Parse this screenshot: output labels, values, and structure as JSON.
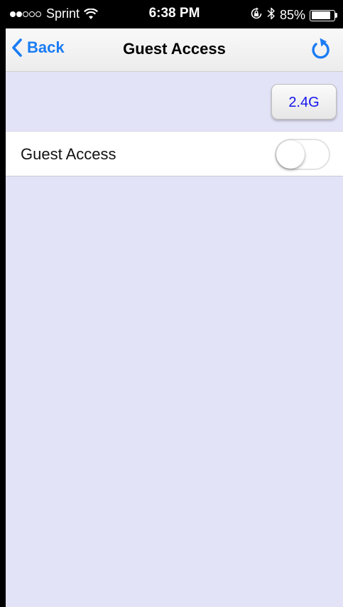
{
  "status_bar": {
    "signal_bars_filled": 2,
    "signal_bars_total": 5,
    "carrier": "Sprint",
    "time": "6:38 PM",
    "battery_percent": "85%",
    "battery_level": 0.85,
    "icons": [
      "wifi-icon",
      "rotation-lock-icon",
      "bluetooth-icon",
      "battery-icon"
    ]
  },
  "nav": {
    "back_label": "Back",
    "title": "Guest Access",
    "accent_color": "#1a7cf3",
    "refresh_icon": "refresh-icon"
  },
  "band_selector": {
    "label": "2.4G",
    "text_color": "#1414ee"
  },
  "settings": {
    "guest_access": {
      "label": "Guest Access",
      "enabled": false
    }
  },
  "colors": {
    "background": "#e3e3f7"
  }
}
